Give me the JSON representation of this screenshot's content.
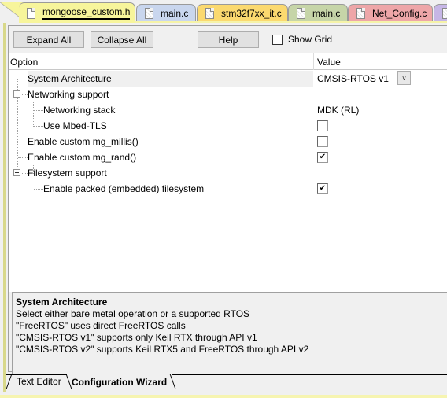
{
  "file_tabs": [
    {
      "label": "mongoose_custom.h",
      "active": true,
      "color": "#f7f59b"
    },
    {
      "label": "main.c",
      "active": false,
      "color": "#c9d6ee"
    },
    {
      "label": "stm32f7xx_it.c",
      "active": false,
      "color": "#fbd96f"
    },
    {
      "label": "main.c",
      "active": false,
      "color": "#c6d5a8"
    },
    {
      "label": "Net_Config.c",
      "active": false,
      "color": "#eea6a8"
    },
    {
      "label": "",
      "active": false,
      "color": "#c6b6e6"
    }
  ],
  "toolbar": {
    "expand_all": "Expand All",
    "collapse_all": "Collapse All",
    "help": "Help",
    "show_grid_label": "Show Grid",
    "show_grid_checked": false
  },
  "grid": {
    "option_header": "Option",
    "value_header": "Value",
    "rows": [
      {
        "label": "System Architecture",
        "level": 0,
        "value_type": "combo",
        "value": "CMSIS-RTOS v1",
        "selected": true
      },
      {
        "label": "Networking support",
        "level": 0,
        "value_type": "none",
        "expandable": true
      },
      {
        "label": "Networking stack",
        "level": 1,
        "value_type": "text",
        "value": "MDK (RL)"
      },
      {
        "label": "Use Mbed-TLS",
        "level": 1,
        "value_type": "checkbox",
        "checked": false
      },
      {
        "label": "Enable custom mg_millis()",
        "level": 0,
        "value_type": "checkbox",
        "checked": false
      },
      {
        "label": "Enable custom mg_rand()",
        "level": 0,
        "value_type": "checkbox",
        "checked": true
      },
      {
        "label": "Filesystem support",
        "level": 0,
        "value_type": "none",
        "expandable": true
      },
      {
        "label": "Enable packed (embedded) filesystem",
        "level": 1,
        "value_type": "checkbox",
        "checked": true
      }
    ]
  },
  "description": {
    "title": "System Architecture",
    "lines": [
      "Select either bare metal operation or a supported RTOS",
      "\"FreeRTOS\" uses direct FreeRTOS calls",
      "\"CMSIS-RTOS v1\" supports only Keil RTX through API v1",
      "\"CMSIS-RTOS v2\" supports Keil RTX5 and FreeRTOS through API v2"
    ]
  },
  "bottom_tabs": {
    "text_editor": "Text Editor",
    "configuration_wizard": "Configuration Wizard"
  },
  "icons": {
    "check": "✔",
    "chevron_down": "∨"
  }
}
